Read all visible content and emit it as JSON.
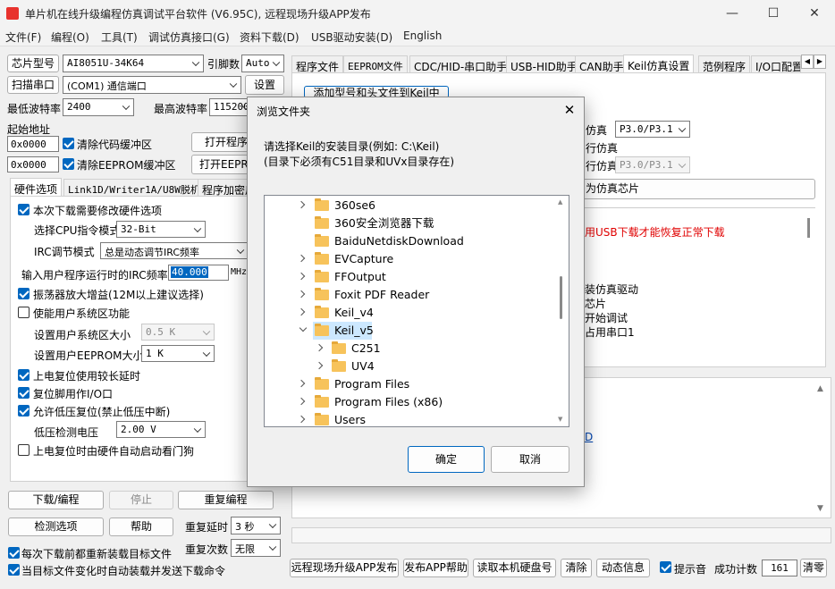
{
  "window": {
    "title": "单片机在线升级编程仿真调试平台软件 (V6.95C), 远程现场升级APP发布"
  },
  "menu": [
    "文件(F)",
    "编程(O)",
    "工具(T)",
    "调试仿真接口(G)",
    "资料下载(D)",
    "USB驱动安装(D)",
    "English"
  ],
  "left": {
    "chip_label": "芯片型号",
    "chip_value": "AI8051U-34K64",
    "pin_label": "引脚数",
    "pin_value": "Auto",
    "scan_label": "扫描串口",
    "port_value": "(COM1) 通信端口",
    "settings_label": "设置",
    "min_baud_label": "最低波特率",
    "min_baud_value": "2400",
    "max_baud_label": "最高波特率",
    "max_baud_value": "115200",
    "start_addr_label": "起始地址",
    "addr1": "0x0000",
    "clear_code": "清除代码缓冲区",
    "open_prog": "打开程序文件",
    "addr2": "0x0000",
    "clear_eeprom": "清除EEPROM缓冲区",
    "open_eeprom": "打开EEPROM文件",
    "tabs": [
      "硬件选项",
      "Link1D/Writer1A/U8W脱机",
      "程序加密后传输"
    ],
    "hw": {
      "modify": "本次下载需要修改硬件选项",
      "cpu_label": "选择CPU指令模式",
      "cpu_value": "32-Bit",
      "irc_mode_label": "IRC调节模式",
      "irc_mode_value": "总是动态调节IRC频率",
      "irc_freq_label": "输入用户程序运行时的IRC频率",
      "irc_freq_value": "40.000",
      "irc_unit": "MHz",
      "osc_gain": "振荡器放大增益(12M以上建议选择)",
      "user_sys": "使能用户系统区功能",
      "user_sys_size_label": "设置用户系统区大小",
      "user_sys_size_value": "0.5 K",
      "eeprom_size_label": "设置用户EEPROM大小",
      "eeprom_size_value": "1 K",
      "long_delay": "上电复位使用较长延时",
      "reset_io": "复位脚用作I/O口",
      "lvr": "允许低压复位(禁止低压中断)",
      "lvd_label": "低压检测电压",
      "lvd_value": "2.00 V",
      "wdt": "上电复位时由硬件自动启动看门狗"
    },
    "download": "下载/编程",
    "stop": "停止",
    "reprog": "重复编程",
    "check": "检测选项",
    "help": "帮助",
    "repeat_delay_label": "重复延时",
    "repeat_delay_value": "3 秒",
    "repeat_count_label": "重复次数",
    "repeat_count_value": "无限",
    "reload": "每次下载前都重新装载目标文件",
    "autosend": "当目标文件变化时自动装载并发送下载命令"
  },
  "right": {
    "tabs": [
      "程序文件",
      "EEPROM文件",
      "CDC/HID-串口助手",
      "USB-HID助手",
      "CAN助手",
      "Keil仿真设置",
      "范例程序",
      "I/O口配置"
    ],
    "add_btn": "添加型号和头文件到Keil中",
    "sim_label": "仿真",
    "sim_value": "P3.0/P3.1",
    "sim2_label": "行仿真",
    "sim3_label": "行仿真",
    "sim3_value": "P3.0/P3.1",
    "chip_btn": "为仿真芯片",
    "usb_warning": "用USB下载才能恢复正常下载",
    "lines": [
      "装仿真驱动",
      "芯片",
      "开始调试",
      "占用串口1"
    ],
    "link_frag": "D"
  },
  "bottom": {
    "remote": "远程现场升级APP发布",
    "publish_help": "发布APP帮助",
    "read_disk": "读取本机硬盘号",
    "clear": "清除",
    "dynamic": "动态信息",
    "beep": "提示音",
    "success_label": "成功计数",
    "success_value": "161",
    "clear2": "清零"
  },
  "dialog": {
    "title": "浏览文件夹",
    "line1": "请选择Keil的安装目录(例如: C:\\Keil)",
    "line2": "(目录下必须有C51目录和UVx目录存在)",
    "tree": [
      "360se6",
      "360安全浏览器下载",
      "BaiduNetdiskDownload",
      "EVCapture",
      "FFOutput",
      "Foxit PDF Reader",
      "Keil_v4",
      "Keil_v5",
      "C251",
      "UV4",
      "Program Files",
      "Program Files (x86)",
      "Users"
    ],
    "ok": "确定",
    "cancel": "取消"
  },
  "colors": {
    "accent": "#0067c0",
    "selection": "#cce8ff",
    "warning": "#e00000",
    "folder": "#f7c35b"
  }
}
